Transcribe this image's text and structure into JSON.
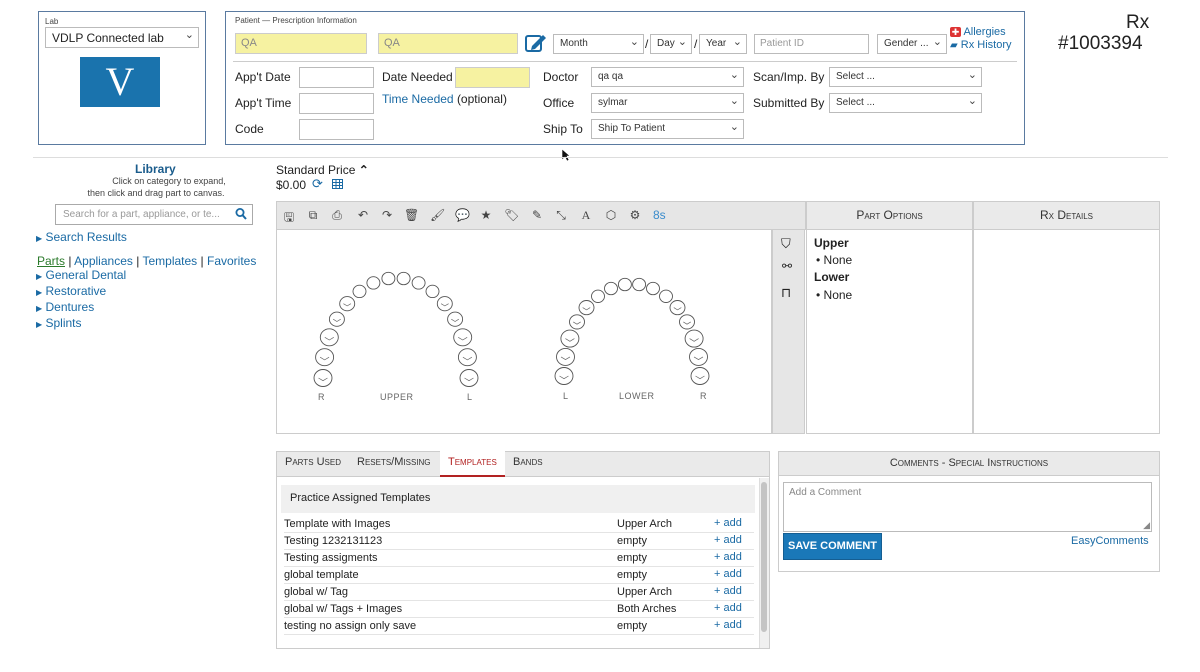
{
  "lab": {
    "label": "Lab",
    "selected": "VDLP Connected lab",
    "logo_letter": "V"
  },
  "patient": {
    "section_label": "Patient — Prescription Information",
    "first_name": "QA",
    "last_name": "QA",
    "month": "Month",
    "day": "Day",
    "year": "Year",
    "sep1": "/",
    "sep2": "/",
    "patient_id_placeholder": "Patient ID",
    "gender": "Gender ...",
    "allergies": "Allergies",
    "rx_history": "Rx History"
  },
  "rx": {
    "label": "Rx",
    "number": "#1003394"
  },
  "form": {
    "appt_date": "App't Date",
    "appt_time": "App't Time",
    "code": "Code",
    "date_needed": "Date Needed",
    "time_needed": "Time Needed",
    "optional": "(optional)",
    "doctor_label": "Doctor",
    "doctor": "qa qa",
    "office_label": "Office",
    "office": "sylmar",
    "ship_label": "Ship To",
    "ship": "Ship To Patient",
    "scan_label": "Scan/Imp. By",
    "scan": "Select ...",
    "submitted_label": "Submitted By",
    "submitted": "Select ..."
  },
  "library": {
    "title": "Library",
    "hint1": "Click on category to expand,",
    "hint2": "then click and drag part to canvas.",
    "search_placeholder": "Search for a part, appliance, or te...",
    "search_results": "Search Results",
    "tabs": [
      "Parts",
      "Appliances",
      "Templates",
      "Favorites"
    ],
    "sep": "|",
    "categories": [
      "General Dental",
      "Restorative",
      "Dentures",
      "Splints"
    ]
  },
  "price": {
    "label": "Standard Price",
    "value": "$0.00"
  },
  "toolbar": {
    "timer": "8s"
  },
  "canvas": {
    "upper": "UPPER",
    "lower": "LOWER",
    "r": "R",
    "l": "L"
  },
  "part_options": {
    "title": "Part Options",
    "upper": "Upper",
    "lower": "Lower",
    "upper_val": "None",
    "lower_val": "None"
  },
  "rx_details": {
    "title": "Rx Details"
  },
  "bottom_tabs": [
    "Parts Used",
    "Resets/Missing",
    "Templates",
    "Bands"
  ],
  "templates": {
    "header": "Practice Assigned Templates",
    "add_label": "+ add",
    "rows": [
      {
        "name": "Template with Images",
        "type": "Upper Arch"
      },
      {
        "name": "Testing 1232131123",
        "type": "empty"
      },
      {
        "name": "Testing assigments",
        "type": "empty"
      },
      {
        "name": "global template",
        "type": "empty"
      },
      {
        "name": "global w/ Tag",
        "type": "Upper Arch"
      },
      {
        "name": "global w/ Tags + Images",
        "type": "Both Arches"
      },
      {
        "name": "testing no assign only save",
        "type": "empty"
      }
    ]
  },
  "comments": {
    "title": "Comments - Special Instructions",
    "placeholder": "Add a Comment",
    "save": "SAVE COMMENT",
    "easy": "EasyComments"
  },
  "colors": {
    "accent": "#1a6aa4",
    "logo_bg": "#1a73ad",
    "highlight": "#f6f2a1",
    "active_tab": "#b22222"
  }
}
